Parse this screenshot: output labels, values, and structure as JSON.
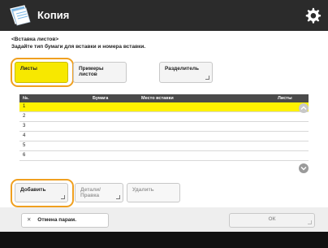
{
  "app": {
    "title": "Копия",
    "icon": "copy-app-icon",
    "settings_icon": "gear-icon"
  },
  "instructions": {
    "line1": "<Вставка листов>",
    "line2": "Задайте тип бумаги для вставки и номера вставки."
  },
  "tabs": [
    {
      "label": "Листы",
      "selected": true
    },
    {
      "label": "Примеры листов",
      "selected": false
    },
    {
      "label": "Разделитель",
      "selected": false
    }
  ],
  "table": {
    "headers": [
      "№.",
      "Бумага",
      "Место вставки",
      "Листы"
    ],
    "rows": [
      {
        "num": "1",
        "selected": true
      },
      {
        "num": "2",
        "selected": false
      },
      {
        "num": "3",
        "selected": false
      },
      {
        "num": "4",
        "selected": false
      },
      {
        "num": "5",
        "selected": false
      },
      {
        "num": "6",
        "selected": false
      }
    ]
  },
  "actions": {
    "add": "Добавить",
    "edit": "Детали/Правка",
    "delete": "Удалить"
  },
  "footer": {
    "cancel": "Отмена парам.",
    "ok": "ОК"
  },
  "colors": {
    "accent_yellow": "#fff200",
    "highlight_orange": "#f0a020",
    "titlebar": "#2b2b2b"
  }
}
